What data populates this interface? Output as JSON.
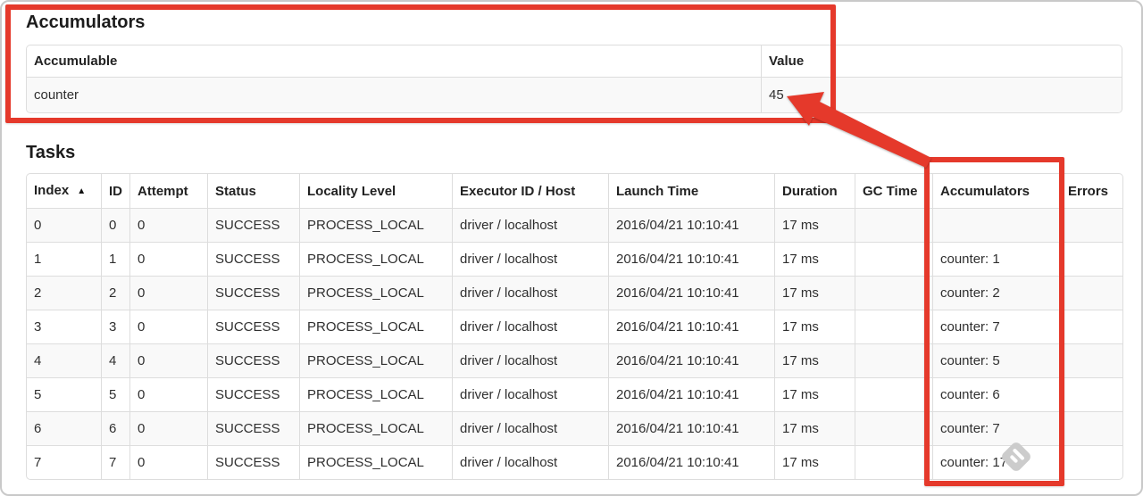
{
  "accumulators_section": {
    "title": "Accumulators",
    "table": {
      "columns": {
        "accumulable": "Accumulable",
        "value": "Value"
      },
      "rows": [
        {
          "accumulable": "counter",
          "value": "45"
        }
      ]
    }
  },
  "tasks_section": {
    "title": "Tasks",
    "table": {
      "columns": {
        "index": "Index",
        "id": "ID",
        "attempt": "Attempt",
        "status": "Status",
        "locality_level": "Locality Level",
        "executor_id_host": "Executor ID / Host",
        "launch_time": "Launch Time",
        "duration": "Duration",
        "gc_time": "GC Time",
        "accumulators": "Accumulators",
        "errors": "Errors"
      },
      "sort": {
        "column": "Index",
        "direction": "ascending",
        "icon": "▲"
      },
      "rows": [
        {
          "index": "0",
          "id": "0",
          "attempt": "0",
          "status": "SUCCESS",
          "locality_level": "PROCESS_LOCAL",
          "executor_id_host": "driver / localhost",
          "launch_time": "2016/04/21 10:10:41",
          "duration": "17 ms",
          "gc_time": "",
          "accumulators": "",
          "errors": ""
        },
        {
          "index": "1",
          "id": "1",
          "attempt": "0",
          "status": "SUCCESS",
          "locality_level": "PROCESS_LOCAL",
          "executor_id_host": "driver / localhost",
          "launch_time": "2016/04/21 10:10:41",
          "duration": "17 ms",
          "gc_time": "",
          "accumulators": "counter: 1",
          "errors": ""
        },
        {
          "index": "2",
          "id": "2",
          "attempt": "0",
          "status": "SUCCESS",
          "locality_level": "PROCESS_LOCAL",
          "executor_id_host": "driver / localhost",
          "launch_time": "2016/04/21 10:10:41",
          "duration": "17 ms",
          "gc_time": "",
          "accumulators": "counter: 2",
          "errors": ""
        },
        {
          "index": "3",
          "id": "3",
          "attempt": "0",
          "status": "SUCCESS",
          "locality_level": "PROCESS_LOCAL",
          "executor_id_host": "driver / localhost",
          "launch_time": "2016/04/21 10:10:41",
          "duration": "17 ms",
          "gc_time": "",
          "accumulators": "counter: 7",
          "errors": ""
        },
        {
          "index": "4",
          "id": "4",
          "attempt": "0",
          "status": "SUCCESS",
          "locality_level": "PROCESS_LOCAL",
          "executor_id_host": "driver / localhost",
          "launch_time": "2016/04/21 10:10:41",
          "duration": "17 ms",
          "gc_time": "",
          "accumulators": "counter: 5",
          "errors": ""
        },
        {
          "index": "5",
          "id": "5",
          "attempt": "0",
          "status": "SUCCESS",
          "locality_level": "PROCESS_LOCAL",
          "executor_id_host": "driver / localhost",
          "launch_time": "2016/04/21 10:10:41",
          "duration": "17 ms",
          "gc_time": "",
          "accumulators": "counter: 6",
          "errors": ""
        },
        {
          "index": "6",
          "id": "6",
          "attempt": "0",
          "status": "SUCCESS",
          "locality_level": "PROCESS_LOCAL",
          "executor_id_host": "driver / localhost",
          "launch_time": "2016/04/21 10:10:41",
          "duration": "17 ms",
          "gc_time": "",
          "accumulators": "counter: 7",
          "errors": ""
        },
        {
          "index": "7",
          "id": "7",
          "attempt": "0",
          "status": "SUCCESS",
          "locality_level": "PROCESS_LOCAL",
          "executor_id_host": "driver / localhost",
          "launch_time": "2016/04/21 10:10:41",
          "duration": "17 ms",
          "gc_time": "",
          "accumulators": "counter: 17",
          "errors": ""
        }
      ]
    }
  },
  "annotations": {
    "color": "#e5392b",
    "watermark_color": "#cccccc"
  }
}
